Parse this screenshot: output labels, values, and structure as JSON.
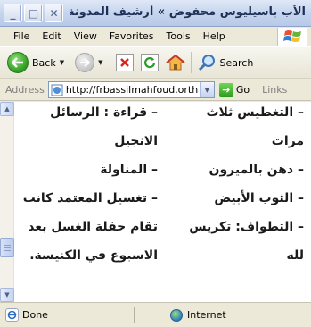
{
  "window": {
    "title": "الأب باسيليوس محفوض » أرشيف المدونة ...",
    "minimize_glyph": "_",
    "maximize_glyph": "□",
    "close_glyph": "✕"
  },
  "menu": [
    "File",
    "Edit",
    "View",
    "Favorites",
    "Tools",
    "Help"
  ],
  "toolbar": {
    "back_label": "Back",
    "search_label": "Search"
  },
  "address": {
    "label": "Address",
    "url": "http://frbassilmahfoud.orthod",
    "go_label": "Go",
    "links_label": "Links"
  },
  "content": {
    "right_column": [
      "– التغطيس ثلاث",
      "مرات",
      "– دهن بالميرون",
      "– الثوب الأبيض",
      "– التطواف: تكريس",
      "لله"
    ],
    "left_column": [
      "– قراءة : الرسائل",
      "الانجيل",
      "– المناولة",
      "– تغسيل المعتمد كانت",
      "تقام حفلة الغسل بعد",
      "الاسبوع في الكنيسة."
    ]
  },
  "status": {
    "text": "Done",
    "zone": "Internet"
  }
}
